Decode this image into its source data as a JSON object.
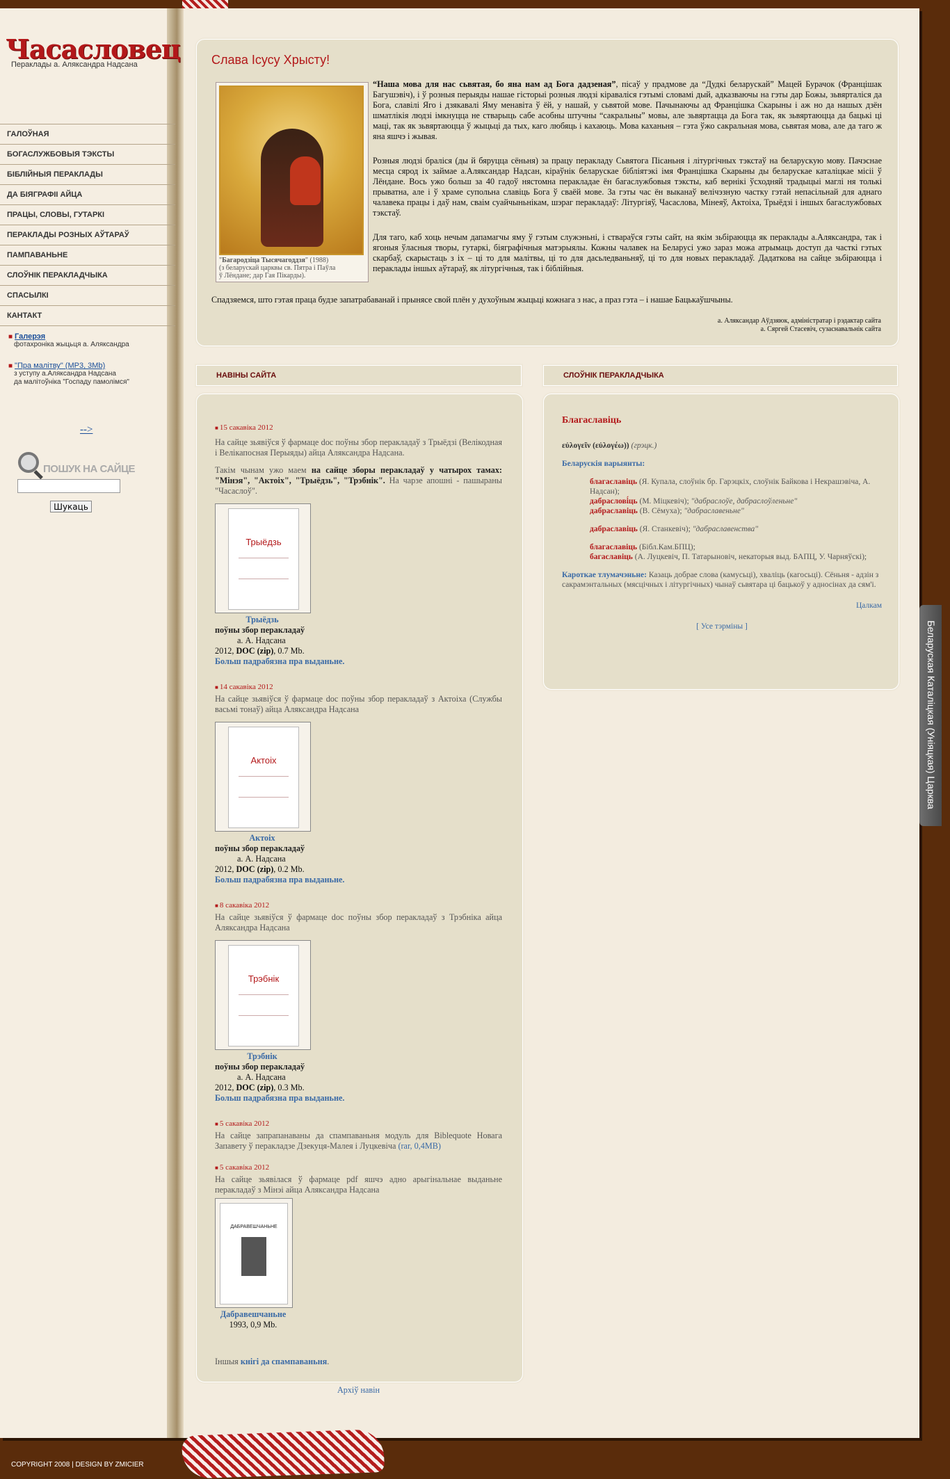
{
  "site": {
    "logo_title": "Часасловец",
    "logo_subtitle": "Пераклады а. Аляксандра Надсана",
    "copyright": "COPYRIGHT 2008 | DESIGN BY ZMICIER",
    "right_tab": "Беларуская Каталіцкая (Уніяцкая) Царква"
  },
  "nav": [
    "ГАЛОЎНАЯ",
    "БОГАСЛУЖБОВЫЯ ТЭКСТЫ",
    "БІБЛІЙНЫЯ ПЕРАКЛАДЫ",
    "ДА БІЯГРАФІІ АЙЦА",
    "ПРАЦЫ, СЛОВЫ, ГУТАРКІ",
    "ПЕРАКЛАДЫ РОЗНЫХ АЎТАРАЎ",
    "ПАМПАВАНЬНЕ",
    "СЛОЎНІК ПЕРАКЛАДЧЫКА",
    "СПАСЫЛКІ",
    "КАНТАКТ"
  ],
  "side_links": {
    "gallery_label": "Галерэя",
    "gallery_desc": "фотахроніка жыцьця а. Аляксандра",
    "prayer_label": "\"Пра малітву\" (MP3, 3Mb)",
    "prayer_desc_1": "з уступу а.Аляксандра Надсана",
    "prayer_desc_2": "да малітоўніка \"Госпаду памолімся\"",
    "arrow_link": "-->"
  },
  "search": {
    "label": "ПОШУК НА САЙЦЕ",
    "button": "Шукаць",
    "value": ""
  },
  "welcome": {
    "title": "Слава Ісусу Хрысту!",
    "icon_caption_bold": "Багародзіца Тысячагоддзя",
    "icon_caption_year": " (1988)",
    "icon_caption_2": "(з беларускай царквы св. Пятра і Паўла",
    "icon_caption_3": "ў Лёндане; дар Гая Пікарды).",
    "p1_bold": "“Наша мова для нас сьвятая, бо яна нам ад Бога дадзеная”",
    "p1": ", пісаў у прадмове да “Дудкі беларускай” Мацей Бурачок (Францішак Багушэвіч), і ў розныя перыяды нашае гісторыі розныя людзі кіраваліся гэтымі словамі дый, адказваючы на гэты дар Божы, зьвярталіся да Бога, славілі Яго і дзякавалі Яму менавіта ў ёй, у нашай, у сьвятой мове. Пачынаючы ад Францішка Скарыны і аж но да нашых дзён шматлікія людзі імкнуцца не стварыць сабе асобны штучны “сакральны” мовы, але зьвяртацца да Бога так, як зьвяртаюцца да бацькі ці маці, так як зьвяртаюцца ў жыцьці да тых, каго любяць і кахаюць. Мова каханьня – гэта ўжо сакральная мова, сьвятая мова, але да таго ж яна яшчэ і жывая.",
    "p2": "Розныя людзі браліся (ды й бяруцца сёньня) за працу перакладу Сьвятога Пісаньня і літургічных тэкстаў на беларускую мову. Пачэснае месца сярод іх займае а.Аляксандар Надсан, кіраўнік беларускае бібліятэкі імя Францішка Скарыны ды беларускае каталіцкае місіі ў Лёндане. Вось ужо больш за 40 гадоў нястомна перакладае ён багаслужбовыя тэксты, каб вернікі ўсходняй традыцыі маглі ня толькі прыватна, але і ў храме супольна славіць Бога ў сваёй мове. За гэты час ён выканаў велічэзную частку гэтай непасільнай для аднаго чалавека працы і даў нам, сваім суайчыньнікам, шэраг перакладаў: Літургіяў, Часаслова, Мінеяў, Актоіха, Трыёдзі і іншых багаслужбовых тэкстаў.",
    "p3": "Для таго, каб хоць нечым дапамагчы яму ў гэтым служэньні, і ствараўся гэты сайт, на якім зьбіраюцца як пераклады а.Аляксандра, так і ягоныя ўласныя творы, гутаркі, біяграфічныя матэрыялы. Кожны чалавек на Беларусі ужо зараз можа атрымаць доступ да часткі гэтых скарбаў, скарыстаць з іх – ці то для малітвы, ці то для дасьледваньняў, ці то для новых перакладаў. Дадаткова на сайце зьбіраюцца і пераклады іншых аўтараў, як літургічныя, так і біблійныя.",
    "closing": "Спадзяемся, што гэтая праца будзе запатрабаванай і прынясе свой плён у духоўным жыцьці кожнага з нас, а праз гэта – і нашае Бацькаўшчыны.",
    "sign_1": "а. Аляксандар Аўдзяюк, адміністратар і рэдактар сайта",
    "sign_2": "а. Сяргей Стасевіч, сузаснавальнік сайта"
  },
  "news": {
    "header": "НАВІНЫ САЙТА",
    "item1_date": "15 сакавіка 2012",
    "item1_text": "На сайце зьявіўся ў фармаце doc поўны збор перакладаў з Трыёдзі (Велікодная і Велікапосная Перыяды) айца Аляксандра Надсана.",
    "item1_text2_a": "Такім чынам ужо маем ",
    "item1_text2_b": "на сайце зборы перакладаў у чатырох тамах: \"Мінэя\", \"Актоіх\", \"Трыёдзь\", \"Трэбнік\".",
    "item1_text2_c": " На чарзе апошні - пашыраны \"Часаслоў\".",
    "book1_cover": "Трыёдзь",
    "book1_title": "Трыёдзь",
    "book1_sub": "поўны збор перакладаў",
    "book1_author": "а. А. Надсана",
    "book1_year": "2012, ",
    "book1_fmt": "DOC (zip)",
    "book1_size": ", 0.7 Mb.",
    "book1_more": "Больш падрабязна пра выданьне.",
    "item2_date": "14 сакавіка 2012",
    "item2_text": "На сайце зьявіўся ў фармаце doc поўны збор перакладаў з Актоіха (Службы васьмі тонаў) айца Аляксандра Надсана",
    "book2_cover": "Актоіх",
    "book2_title": "Актоіх",
    "book2_sub": "поўны збор перакладаў",
    "book2_author": "а. А. Надсана",
    "book2_year": "2012, ",
    "book2_fmt": "DOC (zip)",
    "book2_size": ", 0.2 Mb.",
    "book2_more": "Больш падрабязна пра выданьне.",
    "item3_date": "8 сакавіка 2012",
    "item3_text": "На сайце зьявіўся ў фармаце doc поўны збор перакладаў з Трэбніка айца Аляксандра Надсана",
    "book3_cover": "Трэбнік",
    "book3_title": "Трэбнік",
    "book3_sub": "поўны збор перакладаў",
    "book3_author": "а. А. Надсана",
    "book3_year": "2012, ",
    "book3_fmt": "DOC (zip)",
    "book3_size": ", 0.3 Mb.",
    "book3_more": "Больш падрабязна пра выданьне.",
    "item4_date": "5 сакавіка 2012",
    "item4_text": "На сайце запрапанаваны да спампаваньня модуль для Biblequote Новага Запавету ў перакладзе Дзекуця-Малея і Луцкевіча ",
    "item4_link": "(rar, 0,4MB)",
    "item5_date": "5 сакавіка 2012",
    "item5_text": "На сайце зьявілася ў фармаце pdf яшчэ адно арыгінальнае выданьне перакладаў з Мінэі айца Аляксандра Надсана",
    "book4_cover": "ДАБРАВЕШЧАНЬНЕ",
    "book4_title": "Дабравешчаньне",
    "book4_year": "1993, 0,9 Mb.",
    "other_a": "Іншыя ",
    "other_link": "кнігі да спампаваньня",
    "other_b": ".",
    "archive": "Архіў навін"
  },
  "dict": {
    "header": "СЛОЎНІК ПЕРАКЛАДЧЫКА",
    "word": "Благаславіць",
    "greek": "εὐλογεῖν (εὐλογέω))",
    "greek_note": " (грэцк.)",
    "variants_label": "Беларускія варыянты:",
    "v1": "благаславіць",
    "v1_src": " (Я. Купала, слоўнік бр. Гарэцкіх, слоўнік Байкова і Некрашэвіча, А. Надсан);",
    "v2": "дабраслові́ць",
    "v2_src": " (М. Міцкевіч); ",
    "v2_ex": "\"дабраслоўе, дабраслоўленьне\"",
    "v3": "дабраславіць",
    "v3_src": " (В. Сёмуха); ",
    "v3_ex": "\"дабраславеньне\"",
    "v4": "дабраславіць",
    "v4_src": " (Я. Станкевіч); ",
    "v4_ex": "\"дабраславенства\"",
    "v5": "благаславіць",
    "v5_src": " (Бібл.Кам.БПЦ);",
    "v6": "багаславіць",
    "v6_src": " (А. Луцкевіч, П. Татарыновіч, некаторыя выд. БАПЦ, У. Чарняўскі);",
    "short_label": "Кароткае тлумачэньне:",
    "short_text": " Казаць добрае слова (камусьці), хваліць (кагосьці). Сёньня - адзін з сакрамэнтальных (мясцічных і літургічных) чынаў сьвятара ці бацькоў у адносінах да сям'і.",
    "full_link": "Цалкам",
    "all_terms": "[ Усе тэрміны ]"
  },
  "colors": {
    "accent_red": "#b3181a",
    "link_blue": "#3a6aa6",
    "background_brown": "#5a2c0b",
    "panel": "#e5dfca"
  }
}
